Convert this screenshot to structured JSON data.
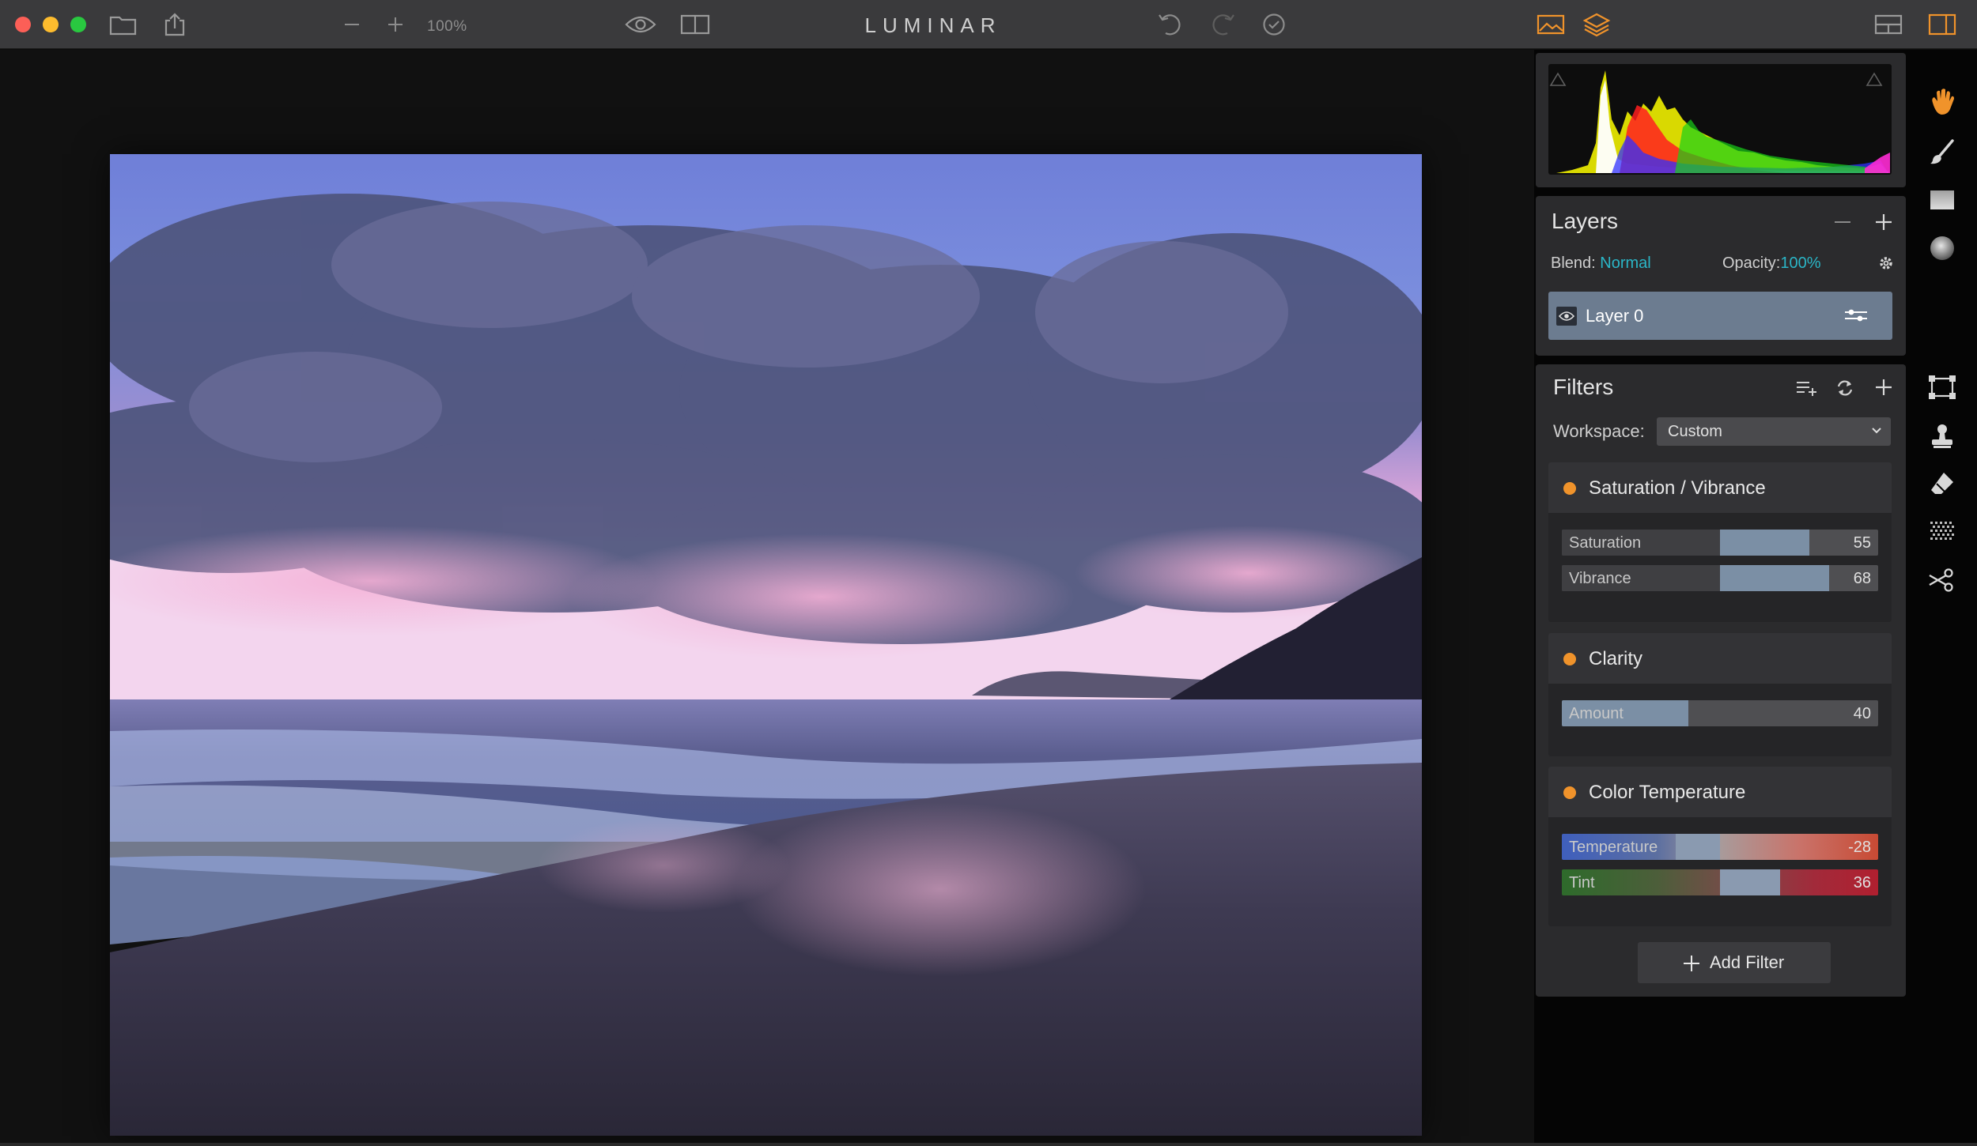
{
  "app": {
    "title": "LUMINAR",
    "zoom_level": "100%"
  },
  "toolbar": {
    "icons": [
      "folder-icon",
      "share-icon",
      "zoom-out-icon",
      "zoom-in-icon",
      "preview-eye-icon",
      "compare-split-icon",
      "undo-icon",
      "redo-icon",
      "history-icon",
      "image-view-icon",
      "layers-view-icon",
      "layout-icon",
      "sidebar-toggle-icon"
    ],
    "accent_color": "#f0932b"
  },
  "layers": {
    "title": "Layers",
    "blend_label": "Blend:",
    "blend_value": "Normal",
    "opacity_label": "Opacity:",
    "opacity_value": "100%",
    "items": [
      {
        "name": "Layer 0",
        "visible": true
      }
    ]
  },
  "filters": {
    "title": "Filters",
    "workspace_label": "Workspace:",
    "workspace_value": "Custom",
    "cards": [
      {
        "name": "Saturation / Vibrance",
        "sliders": [
          {
            "label": "Saturation",
            "value": "55"
          },
          {
            "label": "Vibrance",
            "value": "68"
          }
        ]
      },
      {
        "name": "Clarity",
        "sliders": [
          {
            "label": "Amount",
            "value": "40"
          }
        ]
      },
      {
        "name": "Color Temperature",
        "sliders": [
          {
            "label": "Temperature",
            "value": "-28"
          },
          {
            "label": "Tint",
            "value": "36"
          }
        ]
      }
    ],
    "add_filter_label": "Add Filter"
  },
  "tools": [
    "hand-icon",
    "brush-icon",
    "gradient-mask-icon",
    "radial-mask-icon",
    "crop-icon",
    "clone-stamp-icon",
    "eraser-icon",
    "noise-texture-icon",
    "scissors-icon"
  ]
}
